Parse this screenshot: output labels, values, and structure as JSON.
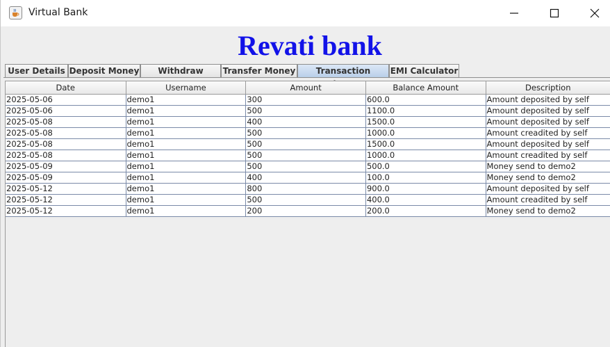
{
  "window": {
    "title": "Virtual Bank",
    "icon": "java-cup-icon"
  },
  "heading": "Revati bank",
  "tabs": [
    {
      "label": "User Details",
      "selected": false
    },
    {
      "label": "Deposit Money",
      "selected": false
    },
    {
      "label": "Withdraw Money",
      "selected": false
    },
    {
      "label": "Transfer Money",
      "selected": false
    },
    {
      "label": "Transaction History",
      "selected": true
    },
    {
      "label": "EMI Calculator",
      "selected": false
    }
  ],
  "table": {
    "columns": [
      "Date",
      "Username",
      "Amount",
      "Balance Amount",
      "Description"
    ],
    "rows": [
      [
        "2025-05-06",
        "demo1",
        "300",
        "600.0",
        "Amount deposited by self"
      ],
      [
        "2025-05-06",
        "demo1",
        "500",
        "1100.0",
        "Amount deposited by self"
      ],
      [
        "2025-05-08",
        "demo1",
        "400",
        "1500.0",
        "Amount deposited by self"
      ],
      [
        "2025-05-08",
        "demo1",
        "500",
        "1000.0",
        "Amount creadited by self"
      ],
      [
        "2025-05-08",
        "demo1",
        "500",
        "1500.0",
        "Amount deposited by self"
      ],
      [
        "2025-05-08",
        "demo1",
        "500",
        "1000.0",
        "Amount creadited by self"
      ],
      [
        "2025-05-09",
        "demo1",
        "500",
        "500.0",
        "Money send to demo2"
      ],
      [
        "2025-05-09",
        "demo1",
        "400",
        "100.0",
        "Money send to demo2"
      ],
      [
        "2025-05-12",
        "demo1",
        "800",
        "900.0",
        "Amount deposited by self"
      ],
      [
        "2025-05-12",
        "demo1",
        "500",
        "400.0",
        "Amount creadited by self"
      ],
      [
        "2025-05-12",
        "demo1",
        "200",
        "200.0",
        "Money send to demo2"
      ]
    ]
  },
  "colors": {
    "heading": "#1212e8",
    "selected_tab": "#b9cfe9"
  }
}
